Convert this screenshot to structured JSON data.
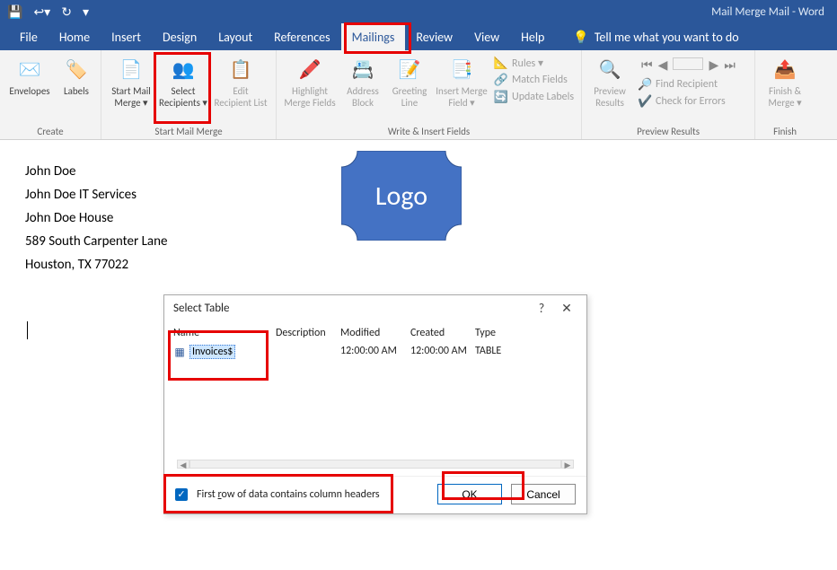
{
  "app_title": "Mail Merge Mail  -  Word",
  "tabs": [
    "File",
    "Home",
    "Insert",
    "Design",
    "Layout",
    "References",
    "Mailings",
    "Review",
    "View",
    "Help"
  ],
  "active_tab": "Mailings",
  "tell_me": "Tell me what you want to do",
  "ribbon": {
    "create": {
      "group_label": "Create",
      "envelopes": "Envelopes",
      "labels": "Labels"
    },
    "start_mm": {
      "group_label": "Start Mail Merge",
      "start": "Start Mail Merge",
      "select_recipients": "Select Recipients",
      "edit_list": "Edit Recipient List"
    },
    "write": {
      "group_label": "Write & Insert Fields",
      "highlight": "Highlight Merge Fields",
      "address": "Address Block",
      "greeting": "Greeting Line",
      "insert_field": "Insert Merge Field",
      "rules": "Rules",
      "match": "Match Fields",
      "update": "Update Labels"
    },
    "preview": {
      "group_label": "Preview Results",
      "preview": "Preview Results",
      "find": "Find Recipient",
      "check": "Check for Errors"
    },
    "finish": {
      "group_label": "Finish",
      "finish": "Finish & Merge"
    }
  },
  "document": {
    "lines": [
      "John Doe",
      "John Doe IT Services",
      "John Doe House",
      "589 South Carpenter Lane",
      "Houston, TX 77022"
    ],
    "logo_text": "Logo"
  },
  "dialog": {
    "title": "Select Table",
    "columns": {
      "name": "Name",
      "desc": "Description",
      "mod": "Modified",
      "crt": "Created",
      "type": "Type"
    },
    "row": {
      "name": "Invoices$",
      "desc": "",
      "mod": "12:00:00 AM",
      "crt": "12:00:00 AM",
      "type": "TABLE"
    },
    "checkbox_label": "First row of data contains column headers",
    "ok": "OK",
    "cancel": "Cancel"
  }
}
